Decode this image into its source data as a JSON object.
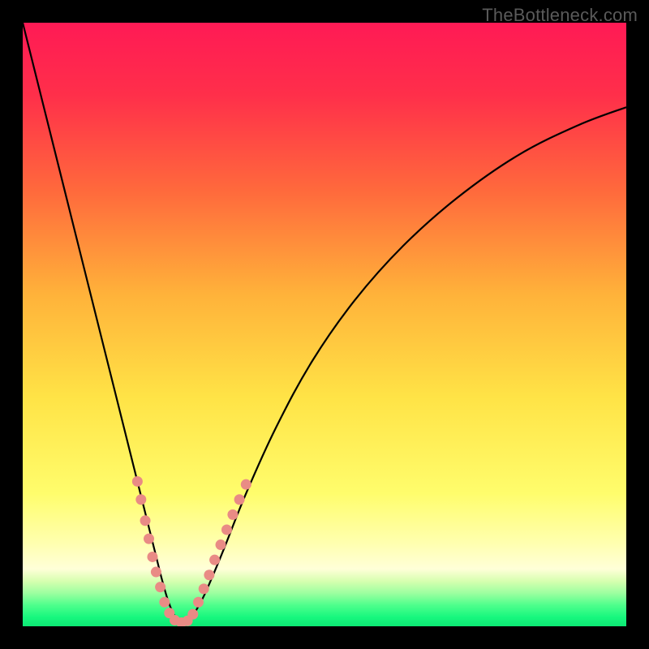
{
  "watermark": "TheBottleneck.com",
  "chart_data": {
    "type": "line",
    "title": "",
    "xlabel": "",
    "ylabel": "",
    "xlim": [
      0,
      100
    ],
    "ylim": [
      0,
      100
    ],
    "background_gradient": {
      "stops": [
        {
          "offset": 0.0,
          "color": "#ff1a55"
        },
        {
          "offset": 0.12,
          "color": "#ff2f4a"
        },
        {
          "offset": 0.28,
          "color": "#ff6a3c"
        },
        {
          "offset": 0.45,
          "color": "#ffb23a"
        },
        {
          "offset": 0.62,
          "color": "#ffe346"
        },
        {
          "offset": 0.78,
          "color": "#fffd6c"
        },
        {
          "offset": 0.86,
          "color": "#ffffad"
        },
        {
          "offset": 0.905,
          "color": "#ffffd8"
        },
        {
          "offset": 0.925,
          "color": "#d7ffb0"
        },
        {
          "offset": 0.945,
          "color": "#9dffa0"
        },
        {
          "offset": 0.965,
          "color": "#4eff8c"
        },
        {
          "offset": 0.985,
          "color": "#17f77e"
        },
        {
          "offset": 1.0,
          "color": "#0de874"
        }
      ]
    },
    "series": [
      {
        "name": "bottleneck-curve",
        "stroke": "#000000",
        "stroke_width": 2.2,
        "x": [
          0,
          2,
          4,
          6,
          8,
          10,
          12,
          14,
          16,
          18,
          20,
          21,
          22,
          23,
          24,
          25,
          26,
          27,
          28,
          30,
          33,
          37,
          42,
          48,
          55,
          63,
          72,
          82,
          92,
          100
        ],
        "y": [
          100,
          92,
          84,
          76,
          68,
          60,
          52,
          44,
          36,
          28,
          20,
          16,
          12,
          8,
          4.5,
          2,
          0.8,
          0.4,
          1.5,
          5,
          12,
          22,
          33,
          44,
          54,
          63,
          71,
          78,
          83,
          86
        ]
      }
    ],
    "markers": {
      "name": "highlight-dots",
      "color": "#e98b85",
      "radius": 6.5,
      "points": [
        {
          "x": 19.0,
          "y": 24.0
        },
        {
          "x": 19.6,
          "y": 21.0
        },
        {
          "x": 20.3,
          "y": 17.5
        },
        {
          "x": 20.9,
          "y": 14.5
        },
        {
          "x": 21.5,
          "y": 11.5
        },
        {
          "x": 22.1,
          "y": 9.0
        },
        {
          "x": 22.8,
          "y": 6.5
        },
        {
          "x": 23.5,
          "y": 4.0
        },
        {
          "x": 24.3,
          "y": 2.2
        },
        {
          "x": 25.2,
          "y": 1.0
        },
        {
          "x": 26.3,
          "y": 0.6
        },
        {
          "x": 27.3,
          "y": 0.9
        },
        {
          "x": 28.2,
          "y": 2.0
        },
        {
          "x": 29.1,
          "y": 4.0
        },
        {
          "x": 30.0,
          "y": 6.2
        },
        {
          "x": 30.9,
          "y": 8.5
        },
        {
          "x": 31.8,
          "y": 11.0
        },
        {
          "x": 32.8,
          "y": 13.5
        },
        {
          "x": 33.8,
          "y": 16.0
        },
        {
          "x": 34.8,
          "y": 18.5
        },
        {
          "x": 35.9,
          "y": 21.0
        },
        {
          "x": 37.0,
          "y": 23.5
        }
      ]
    }
  }
}
